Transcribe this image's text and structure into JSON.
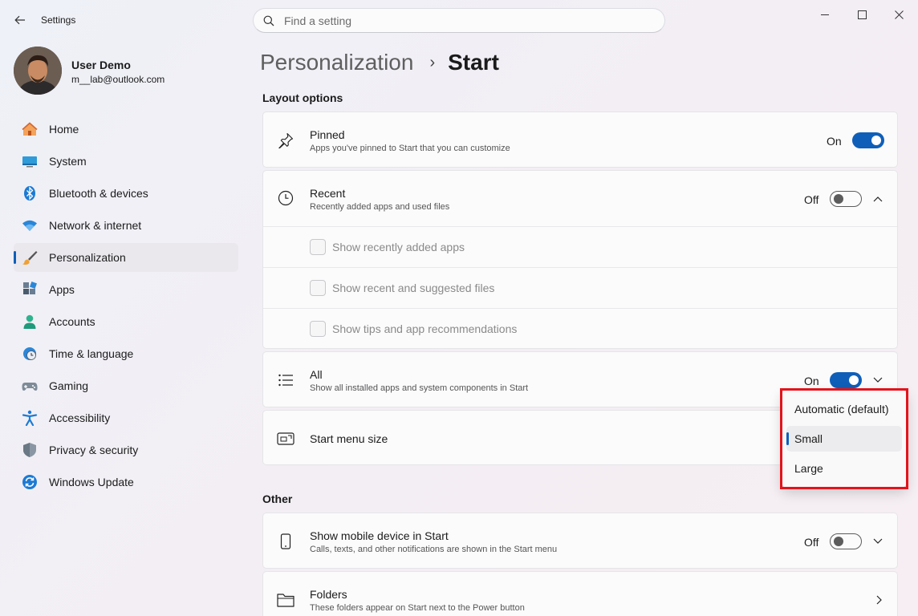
{
  "app": {
    "title": "Settings",
    "search_placeholder": "Find a setting"
  },
  "profile": {
    "name": "User Demo",
    "email": "m__lab@outlook.com"
  },
  "sidebar": {
    "items": [
      {
        "label": "Home",
        "icon": "home-icon"
      },
      {
        "label": "System",
        "icon": "monitor-icon"
      },
      {
        "label": "Bluetooth & devices",
        "icon": "bluetooth-icon"
      },
      {
        "label": "Network & internet",
        "icon": "wifi-icon"
      },
      {
        "label": "Personalization",
        "icon": "paintbrush-icon",
        "active": true
      },
      {
        "label": "Apps",
        "icon": "apps-icon"
      },
      {
        "label": "Accounts",
        "icon": "person-icon"
      },
      {
        "label": "Time & language",
        "icon": "globe-clock-icon"
      },
      {
        "label": "Gaming",
        "icon": "gamepad-icon"
      },
      {
        "label": "Accessibility",
        "icon": "accessibility-icon"
      },
      {
        "label": "Privacy & security",
        "icon": "shield-icon"
      },
      {
        "label": "Windows Update",
        "icon": "update-icon"
      }
    ]
  },
  "breadcrumb": {
    "parent": "Personalization",
    "separator": "›",
    "current": "Start"
  },
  "layout_options": {
    "title": "Layout options",
    "pinned": {
      "title": "Pinned",
      "desc": "Apps you've pinned to Start that you can customize",
      "state": "On"
    },
    "recent": {
      "title": "Recent",
      "desc": "Recently added apps and used files",
      "state": "Off",
      "options": [
        "Show recently added apps",
        "Show recent and suggested files",
        "Show tips and app recommendations"
      ]
    },
    "all": {
      "title": "All",
      "desc": "Show all installed apps and system components in Start",
      "state": "On"
    },
    "size": {
      "title": "Start menu size"
    }
  },
  "size_dropdown": {
    "options": [
      "Automatic (default)",
      "Small",
      "Large"
    ],
    "selected": "Small"
  },
  "other": {
    "title": "Other",
    "mobile": {
      "title": "Show mobile device in Start",
      "desc": "Calls, texts, and other notifications are shown in the Start menu",
      "state": "Off"
    },
    "folders": {
      "title": "Folders",
      "desc": "These folders appear on Start next to the Power button"
    }
  },
  "colors": {
    "accent": "#0f5fb8",
    "highlight_outline": "#e3141b"
  }
}
